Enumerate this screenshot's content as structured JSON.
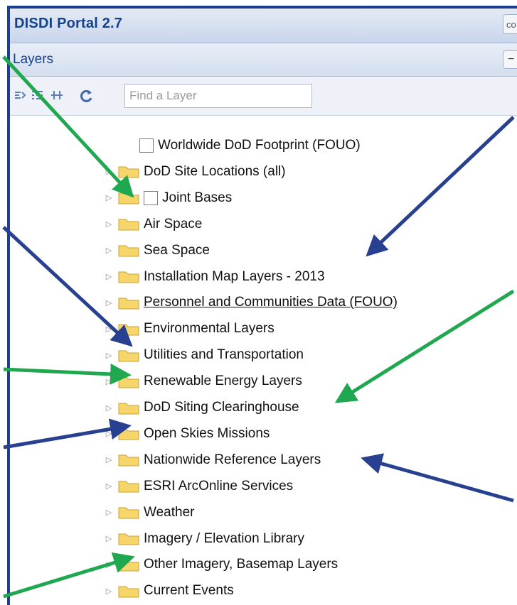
{
  "app": {
    "title": "DISDI Portal 2.7",
    "title_button": "co"
  },
  "panel": {
    "header": "Layers",
    "collapse_symbol": "−"
  },
  "toolbar": {
    "tools": [
      "expand-all-icon",
      "list-icon",
      "collapse-all-icon",
      "refresh-icon"
    ],
    "search_placeholder": "Find a Layer"
  },
  "tree": {
    "items": [
      {
        "label": "Worldwide DoD Footprint (FOUO)",
        "kind": "checkbox"
      },
      {
        "label": "DoD Site Locations (all)",
        "kind": "folder"
      },
      {
        "label": "Joint Bases",
        "kind": "folder-checkbox"
      },
      {
        "label": "Air Space",
        "kind": "folder"
      },
      {
        "label": "Sea Space",
        "kind": "folder"
      },
      {
        "label": "Installation Map Layers - 2013",
        "kind": "folder"
      },
      {
        "label": "Personnel and Communities Data (FOUO)",
        "kind": "folder",
        "link": true
      },
      {
        "label": "Environmental Layers",
        "kind": "folder"
      },
      {
        "label": "Utilities and Transportation",
        "kind": "folder"
      },
      {
        "label": "Renewable Energy Layers",
        "kind": "folder"
      },
      {
        "label": "DoD Siting Clearinghouse",
        "kind": "folder"
      },
      {
        "label": "Open Skies Missions",
        "kind": "folder"
      },
      {
        "label": "Nationwide Reference Layers",
        "kind": "folder"
      },
      {
        "label": "ESRI ArcOnline Services",
        "kind": "folder"
      },
      {
        "label": "Weather",
        "kind": "folder"
      },
      {
        "label": "Imagery / Elevation Library",
        "kind": "folder"
      },
      {
        "label": "Other Imagery, Basemap Layers",
        "kind": "folder"
      },
      {
        "label": "Current Events",
        "kind": "folder"
      }
    ]
  },
  "colors": {
    "border_blue": "#1d3f8f",
    "title_text": "#15428b",
    "arrow_green": "#1fa84f",
    "arrow_blue": "#27408f",
    "folder_fill": "#f6d56a"
  }
}
